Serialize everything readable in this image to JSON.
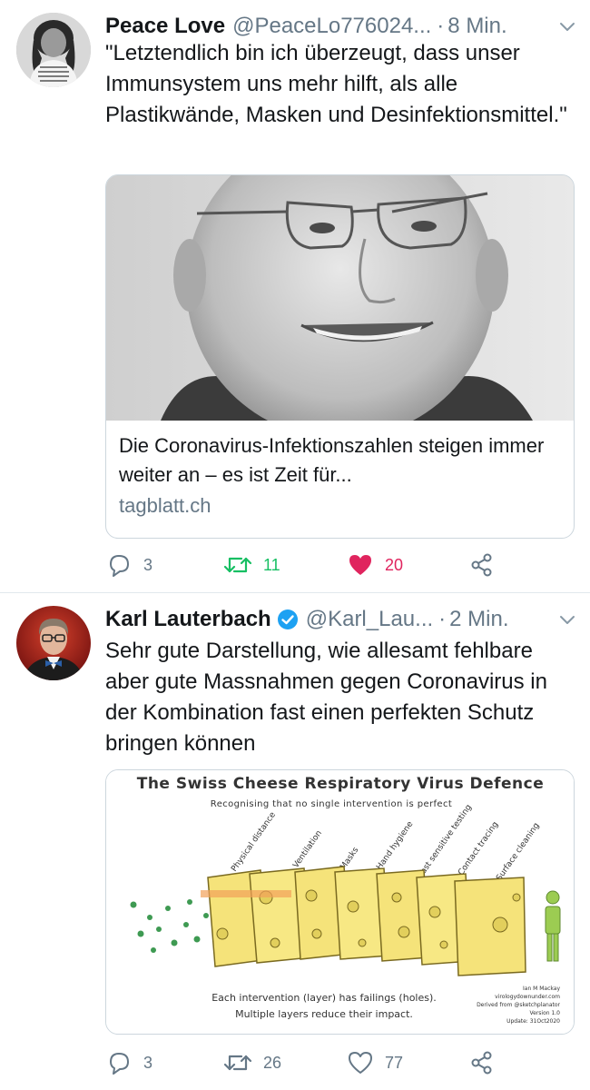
{
  "tweets": [
    {
      "display_name": "Peace Love",
      "handle": "@PeaceLo776024...",
      "separator": "·",
      "time": "8 Min.",
      "text": "\"Letztendlich bin ich überzeugt, dass unser Immunsystem uns mehr hilft, als alle Plastikwände, Masken und Desinfektionsmittel.\"",
      "avatar_shirt_text": [
        "ARCHITECT",
        "RASSE: MENSCH",
        "POLITIK: FREI",
        "RELIGION: LIEBE"
      ],
      "card": {
        "title": "Die Coronavirus-Infektionszahlen steigen immer weiter an – es ist Zeit für...",
        "domain": "tagblatt.ch"
      },
      "actions": {
        "replies": "3",
        "retweets": "11",
        "likes": "20",
        "liked": true,
        "retweeted": true
      }
    },
    {
      "display_name": "Karl Lauterbach",
      "verified": true,
      "handle": "@Karl_Lau...",
      "separator": "·",
      "time": "2 Min.",
      "text": "Sehr gute Darstellung, wie allesamt fehlbare aber gute Massnahmen gegen Coronavirus in der Kombination fast einen perfekten Schutz bringen können",
      "media": {
        "title": "The Swiss Cheese Respiratory Virus Defence",
        "subtitle": "Recognising that no single intervention is perfect",
        "layers": [
          "Physical distance",
          "Ventilation",
          "Masks",
          "Hand hygiene",
          "Fast sensitive testing",
          "Contact tracing",
          "Surface cleaning"
        ],
        "caption_1": "Each intervention (layer) has failings (holes).",
        "caption_2": "Multiple layers reduce their impact.",
        "credit": [
          "Ian M Mackay",
          "virologydownunder.com",
          "Derived from @sketchplanator",
          "Version 1.0",
          "Update: 31Oct2020"
        ]
      },
      "actions": {
        "replies": "3",
        "retweets": "26",
        "likes": "77",
        "liked": false,
        "retweeted": false
      }
    }
  ],
  "colors": {
    "text": "#14171a",
    "muted": "#657786",
    "border": "#ccd6dd",
    "like_active": "#e0245e",
    "retweet_active": "#17bf63",
    "verified": "#1da1f2"
  },
  "icons": {
    "reply": "speech-bubble",
    "retweet": "two-arrows-loop",
    "like": "heart",
    "share": "share-nodes",
    "more": "chevron-down",
    "verified": "check-badge"
  }
}
